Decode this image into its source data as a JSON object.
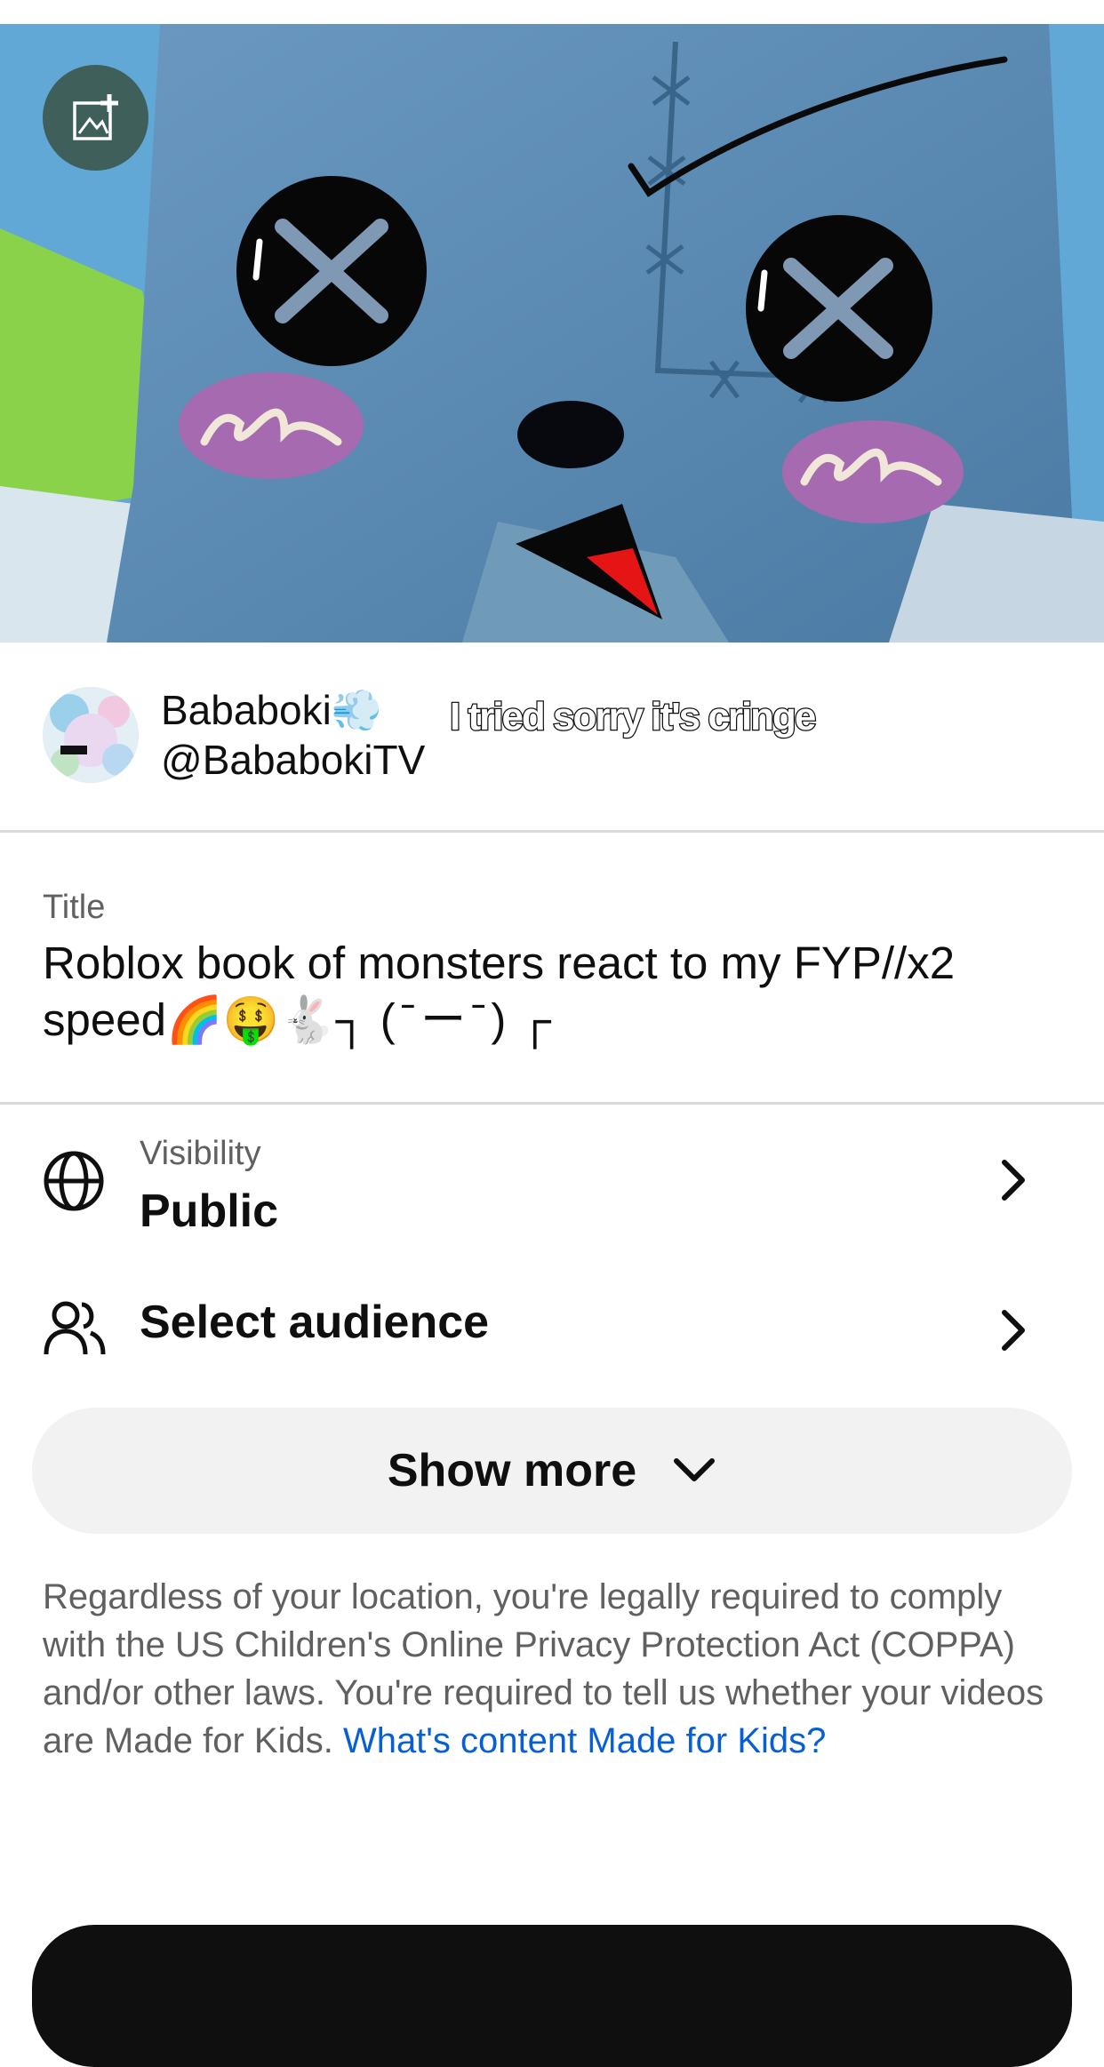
{
  "thumbnail": {
    "edit_icon": "add-image-icon"
  },
  "channel": {
    "name": "Bababoki💨",
    "handle": "@BababokiTV",
    "overlay_caption": "I tried sorry it's cringe"
  },
  "title_field": {
    "label": "Title",
    "value": "Roblox book of monsters react to my FYP//x2 speed🌈🤑🐇┐ (  ̄ ー ̄ ) ┌"
  },
  "visibility": {
    "label": "Visibility",
    "value": "Public",
    "icon": "globe-icon"
  },
  "audience": {
    "label": "Select audience",
    "icon": "people-icon"
  },
  "show_more": {
    "label": "Show more",
    "icon": "chevron-down-icon"
  },
  "legal": {
    "text": "Regardless of your location, you're legally required to comply with the US Children's Online Privacy Protection Act (COPPA) and/or other laws. You're required to tell us whether your videos are Made for Kids. ",
    "link": "What's content Made for Kids?"
  },
  "colors": {
    "link": "#065fd4",
    "secondary_text": "#606060",
    "divider": "#dadada",
    "button_bg": "#f2f2f2"
  }
}
